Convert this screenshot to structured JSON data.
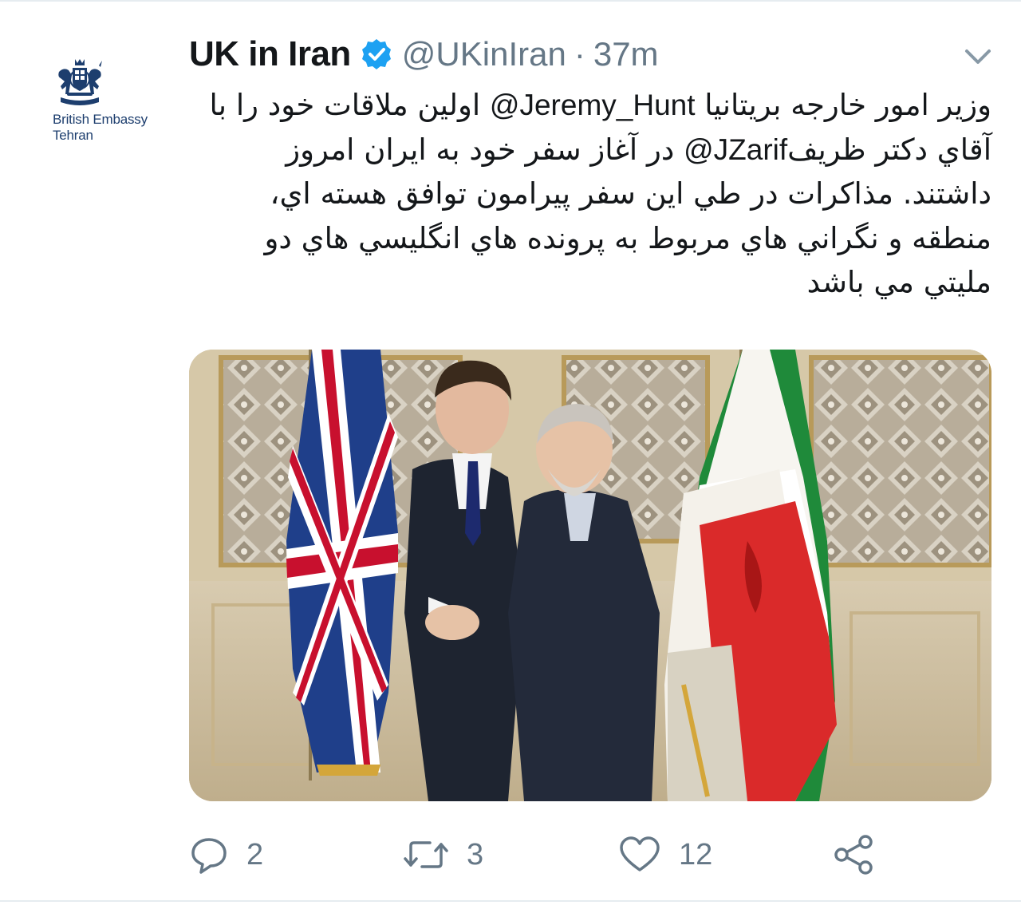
{
  "tweet": {
    "display_name": "UK in Iran",
    "handle": "@UKinIran",
    "separator": "·",
    "time": "37m",
    "text_parts": [
      "وزير امور خارجه بريتانيا ",
      "Jeremy_Hunt@",
      " اولين ملاقات خود را با آقاي دكتر ظريف",
      "JZarif@",
      " در آغاز سفر خود به ايران امروز داشتند. مذاكرات در طي اين سفر پيرامون توافق هسته اي، منطقه و نگراني هاي مربوط به پرونده هاي انگليسي هاي دو مليتي مي باشد"
    ],
    "avatar": {
      "line1": "British Embassy",
      "line2": "Tehran"
    },
    "icons": {
      "verified": "verified-badge-icon",
      "caret": "chevron-down-icon",
      "reply": "reply-icon",
      "retweet": "retweet-icon",
      "like": "heart-icon",
      "share": "share-icon"
    },
    "actions": {
      "reply_count": "2",
      "retweet_count": "3",
      "like_count": "12"
    },
    "colors": {
      "accent": "#1da1f2",
      "muted": "#657786",
      "text": "#14171a"
    }
  }
}
